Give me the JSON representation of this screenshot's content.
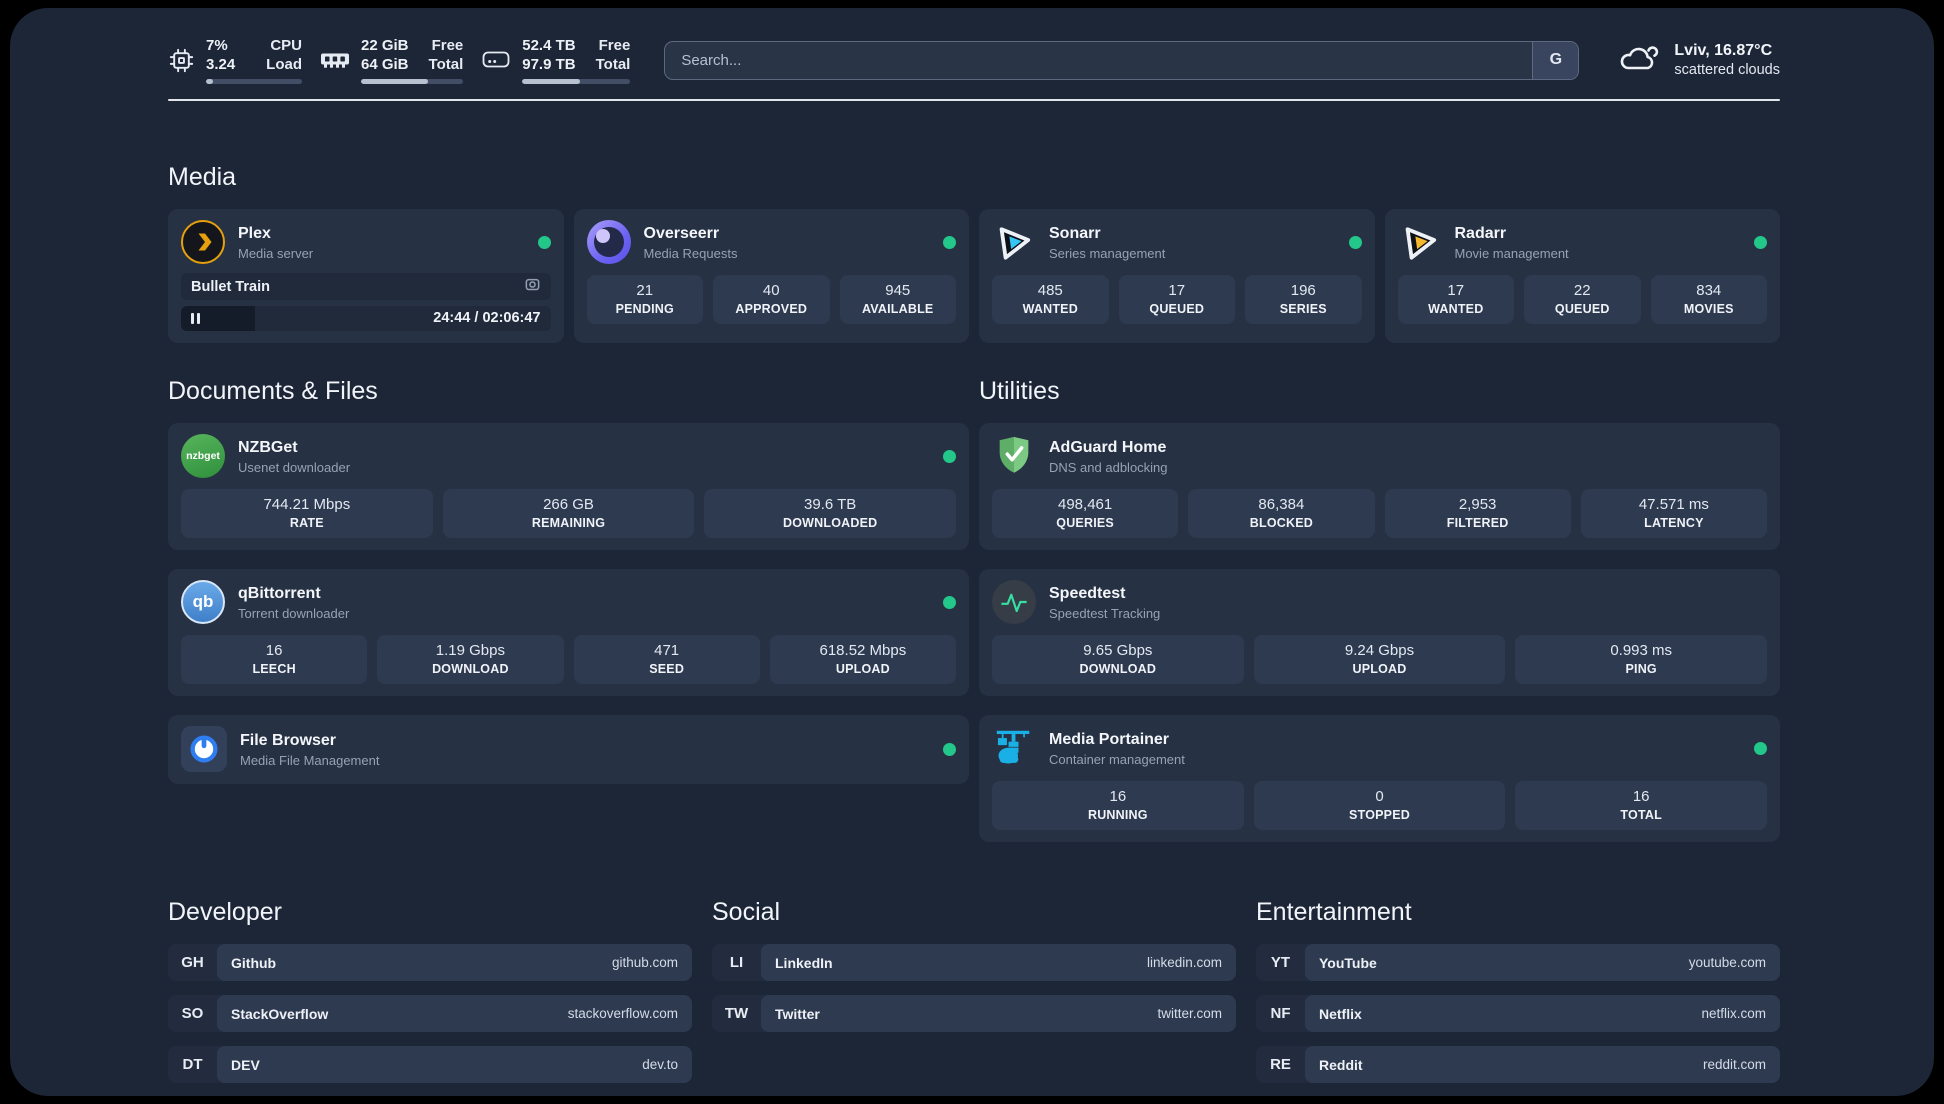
{
  "colors": {
    "status_online": "#22c789",
    "page_background": "#1d2636",
    "card_background": "#263143",
    "plex_accent": "#e5a00d",
    "sonarr_accent": "#36c6f4",
    "radarr_accent": "#f5b82e",
    "portainer_accent": "#1ab0e6",
    "adguard_accent": "#67b96f",
    "speedtest_accent": "#35e0a1"
  },
  "topbar": {
    "cpu": {
      "value_top": "7%",
      "value_bottom": "3.24",
      "label_top": "CPU",
      "label_bottom": "Load",
      "progress": 7
    },
    "memory": {
      "value_top": "22 GiB",
      "value_bottom": "64 GiB",
      "label_top": "Free",
      "label_bottom": "Total",
      "progress": 66
    },
    "disk": {
      "value_top": "52.4 TB",
      "value_bottom": "97.9 TB",
      "label_top": "Free",
      "label_bottom": "Total",
      "progress": 53
    },
    "search": {
      "placeholder": "Search...",
      "engine_button": "G"
    },
    "weather": {
      "location_temp": "Lviv, 16.87°C",
      "condition": "scattered clouds"
    }
  },
  "media": {
    "title": "Media",
    "plex": {
      "name": "Plex",
      "desc": "Media server",
      "now_playing": "Bullet Train",
      "time": "24:44 / 02:06:47",
      "progress": 20
    },
    "overseerr": {
      "name": "Overseerr",
      "desc": "Media Requests",
      "stats": [
        {
          "value": "21",
          "label": "PENDING"
        },
        {
          "value": "40",
          "label": "APPROVED"
        },
        {
          "value": "945",
          "label": "AVAILABLE"
        }
      ]
    },
    "sonarr": {
      "name": "Sonarr",
      "desc": "Series management",
      "stats": [
        {
          "value": "485",
          "label": "WANTED"
        },
        {
          "value": "17",
          "label": "QUEUED"
        },
        {
          "value": "196",
          "label": "SERIES"
        }
      ]
    },
    "radarr": {
      "name": "Radarr",
      "desc": "Movie management",
      "stats": [
        {
          "value": "17",
          "label": "WANTED"
        },
        {
          "value": "22",
          "label": "QUEUED"
        },
        {
          "value": "834",
          "label": "MOVIES"
        }
      ]
    }
  },
  "documents": {
    "title": "Documents & Files",
    "nzbget": {
      "name": "NZBGet",
      "desc": "Usenet downloader",
      "logo_text": "nzbget",
      "stats": [
        {
          "value": "744.21 Mbps",
          "label": "RATE"
        },
        {
          "value": "266 GB",
          "label": "REMAINING"
        },
        {
          "value": "39.6 TB",
          "label": "DOWNLOADED"
        }
      ]
    },
    "qbittorrent": {
      "name": "qBittorrent",
      "desc": "Torrent downloader",
      "logo_text": "qb",
      "stats": [
        {
          "value": "16",
          "label": "LEECH"
        },
        {
          "value": "1.19 Gbps",
          "label": "DOWNLOAD"
        },
        {
          "value": "471",
          "label": "SEED"
        },
        {
          "value": "618.52 Mbps",
          "label": "UPLOAD"
        }
      ]
    },
    "filebrowser": {
      "name": "File Browser",
      "desc": "Media File Management"
    }
  },
  "utilities": {
    "title": "Utilities",
    "adguard": {
      "name": "AdGuard Home",
      "desc": "DNS and adblocking",
      "stats": [
        {
          "value": "498,461",
          "label": "QUERIES"
        },
        {
          "value": "86,384",
          "label": "BLOCKED"
        },
        {
          "value": "2,953",
          "label": "FILTERED"
        },
        {
          "value": "47.571 ms",
          "label": "LATENCY"
        }
      ]
    },
    "speedtest": {
      "name": "Speedtest",
      "desc": "Speedtest Tracking",
      "stats": [
        {
          "value": "9.65 Gbps",
          "label": "DOWNLOAD"
        },
        {
          "value": "9.24 Gbps",
          "label": "UPLOAD"
        },
        {
          "value": "0.993 ms",
          "label": "PING"
        }
      ]
    },
    "portainer": {
      "name": "Media Portainer",
      "desc": "Container management",
      "stats": [
        {
          "value": "16",
          "label": "RUNNING"
        },
        {
          "value": "0",
          "label": "STOPPED"
        },
        {
          "value": "16",
          "label": "TOTAL"
        }
      ]
    }
  },
  "links": [
    {
      "title": "Developer",
      "items": [
        {
          "abbr": "GH",
          "name": "Github",
          "url": "github.com"
        },
        {
          "abbr": "SO",
          "name": "StackOverflow",
          "url": "stackoverflow.com"
        },
        {
          "abbr": "DT",
          "name": "DEV",
          "url": "dev.to"
        }
      ]
    },
    {
      "title": "Social",
      "items": [
        {
          "abbr": "LI",
          "name": "LinkedIn",
          "url": "linkedin.com"
        },
        {
          "abbr": "TW",
          "name": "Twitter",
          "url": "twitter.com"
        }
      ]
    },
    {
      "title": "Entertainment",
      "items": [
        {
          "abbr": "YT",
          "name": "YouTube",
          "url": "youtube.com"
        },
        {
          "abbr": "NF",
          "name": "Netflix",
          "url": "netflix.com"
        },
        {
          "abbr": "RE",
          "name": "Reddit",
          "url": "reddit.com"
        }
      ]
    }
  ]
}
